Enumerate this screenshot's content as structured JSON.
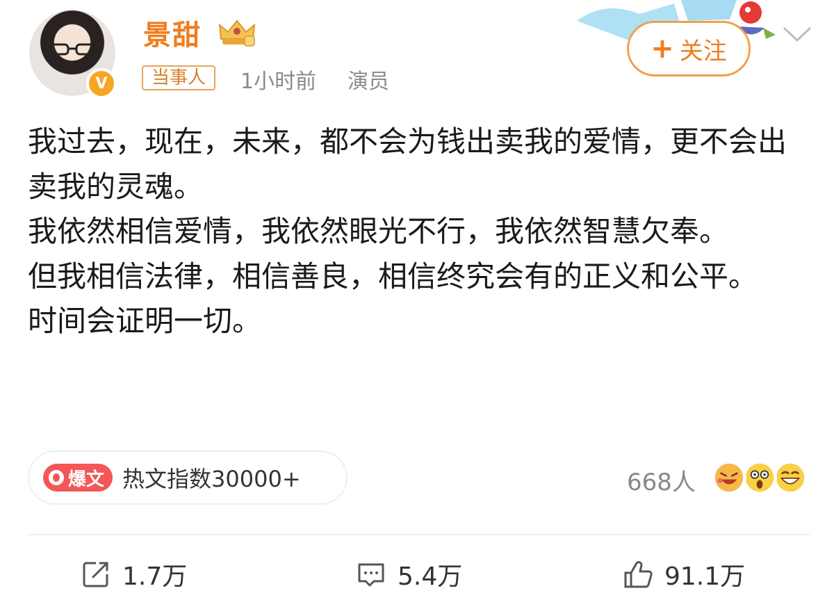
{
  "post": {
    "author": {
      "name": "景甜",
      "verified_mark": "V",
      "tag": "当事人",
      "time": "1小时前",
      "role": "演员"
    },
    "follow_button": {
      "plus": "+",
      "label": "关注"
    },
    "content_lines": [
      "我过去，现在，未来，都不会为钱出卖我的爱情，更不会出卖我的灵魂。",
      "我依然相信爱情，我依然眼光不行，我依然智慧欠奉。",
      "但我相信法律，相信善良，相信终究会有的正义和公平。",
      "时间会证明一切。"
    ],
    "hot": {
      "badge": "爆文",
      "text": "热文指数30000+"
    },
    "reactions": {
      "count": "668人",
      "emoji_icons": [
        "laughing-cry-icon",
        "surprised-icon",
        "grinning-icon"
      ]
    },
    "actions": {
      "repost": "1.7万",
      "comment": "5.4万",
      "like": "91.1万"
    }
  },
  "colors": {
    "brand_orange": "#f07d1e",
    "hot_red": "#f35757",
    "meta_gray": "#8a8a8a"
  }
}
